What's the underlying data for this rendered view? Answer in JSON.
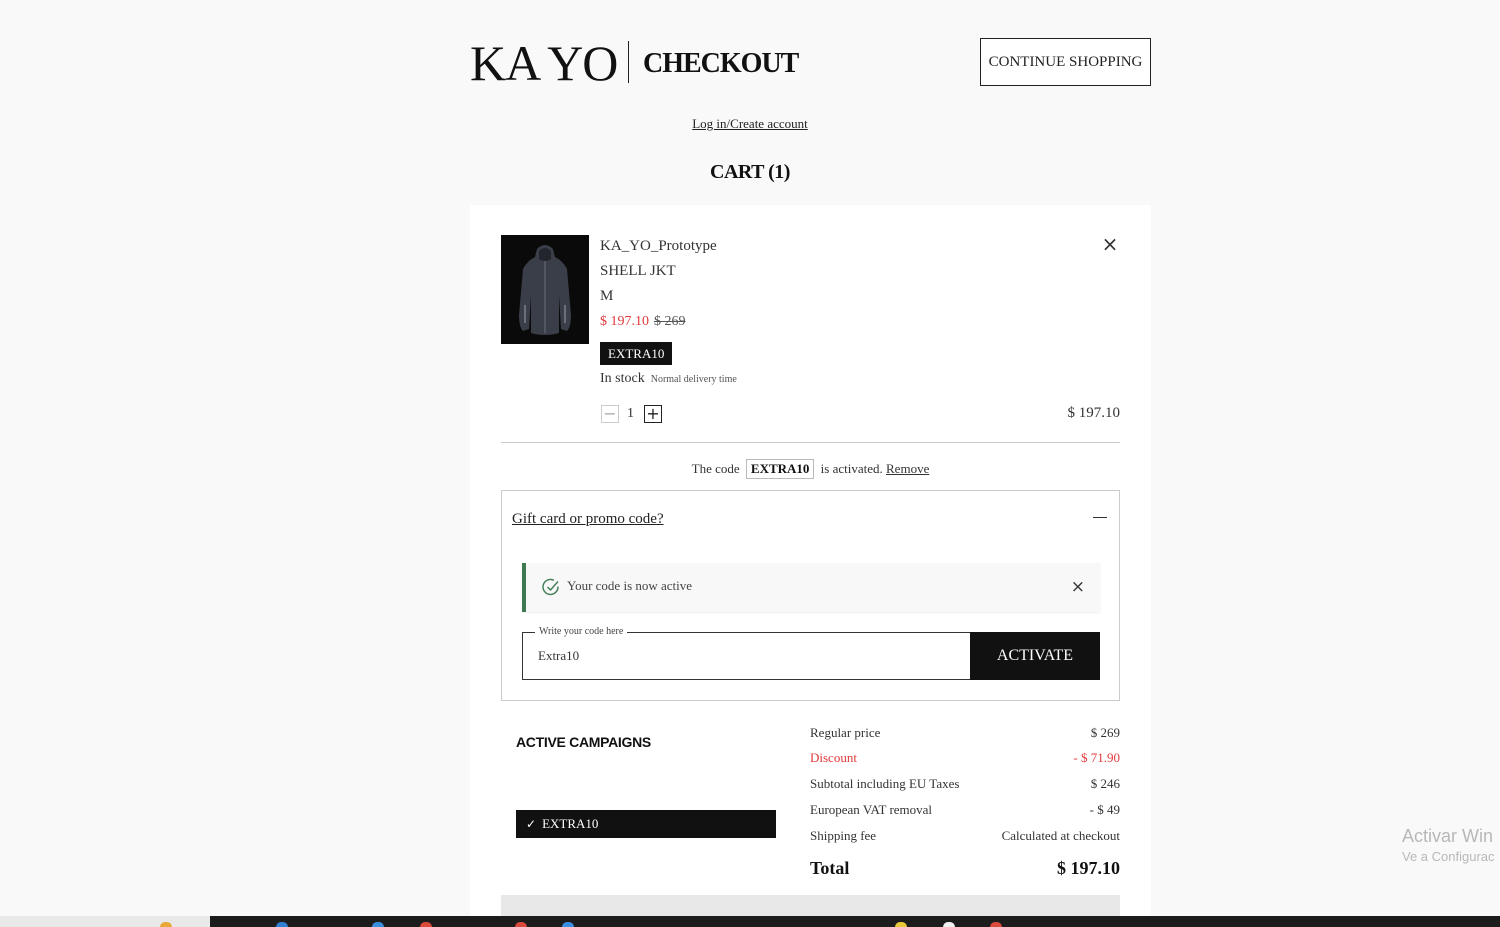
{
  "header": {
    "logo": "KA YO",
    "title": "CHECKOUT",
    "continue_label": "CONTINUE SHOPPING"
  },
  "login_link": "Log in/Create account",
  "cart_title": "CART (1)",
  "product": {
    "image_icon": "jacket-image",
    "name": "KA_YO_Prototype",
    "type": "SHELL JKT",
    "size": "M",
    "sale_price": "$ 197.10",
    "original_price": "$ 269",
    "code_tag": "EXTRA10",
    "stock": "In stock",
    "delivery": "Normal delivery time",
    "quantity": "1",
    "line_total": "$ 197.10"
  },
  "code_activated": {
    "prefix": "The code",
    "code": "EXTRA10",
    "suffix": "is activated.",
    "remove_label": "Remove"
  },
  "promo": {
    "title": "Gift card or promo code?",
    "success_message": "Your code is now active",
    "field_label": "Write your code here",
    "field_value": "Extra10",
    "activate_label": "ACTIVATE"
  },
  "campaigns": {
    "title": "ACTIVE CAMPAIGNS",
    "items": [
      "EXTRA10"
    ]
  },
  "summary": {
    "rows": [
      {
        "label": "Regular price",
        "value": "$ 269"
      },
      {
        "label": "Discount",
        "value": "- $ 71.90"
      },
      {
        "label": "Subtotal including EU Taxes",
        "value": "$ 246"
      },
      {
        "label": "European VAT removal",
        "value": "- $ 49"
      },
      {
        "label": "Shipping fee",
        "value": "Calculated at checkout"
      }
    ],
    "total_label": "Total",
    "total_value": "$ 197.10"
  },
  "watermark": {
    "line1": "Activar Win",
    "line2": "Ve a Configurac"
  },
  "colors": {
    "accent_red": "#e23a3a",
    "success_green": "#3d7a52",
    "dark": "#111111"
  }
}
